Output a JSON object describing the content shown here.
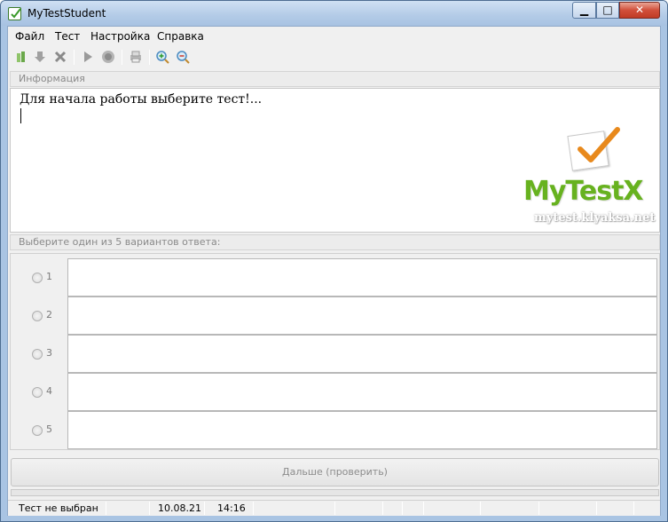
{
  "window": {
    "title": "MyTestStudent"
  },
  "menu": [
    {
      "label": "Файл"
    },
    {
      "label": "Тест"
    },
    {
      "label": "Настройка"
    },
    {
      "label": "Справка"
    }
  ],
  "toolbar": {
    "icons": [
      "open-test-icon",
      "download-icon",
      "close-test-icon",
      "play-icon",
      "stop-icon",
      "print-icon",
      "zoom-in-icon",
      "zoom-out-icon"
    ]
  },
  "info": {
    "label": "Информация",
    "text": "Для начала работы выберите тест!..."
  },
  "logo": {
    "name": "MyTestX",
    "url": "mytest.klyaksa.net"
  },
  "answers": {
    "label": "Выберите один из 5 вариантов ответа:",
    "items": [
      {
        "number": "1",
        "text": ""
      },
      {
        "number": "2",
        "text": ""
      },
      {
        "number": "3",
        "text": ""
      },
      {
        "number": "4",
        "text": ""
      },
      {
        "number": "5",
        "text": ""
      }
    ]
  },
  "next_button": {
    "label": "Дальше (проверить)"
  },
  "status": {
    "test": "Тест не выбран",
    "date": "10.08.21",
    "time": "14:16"
  },
  "colors": {
    "logo_green": "#67b21f",
    "check_orange": "#e8891c",
    "titlebar": "#b3cbe7"
  }
}
